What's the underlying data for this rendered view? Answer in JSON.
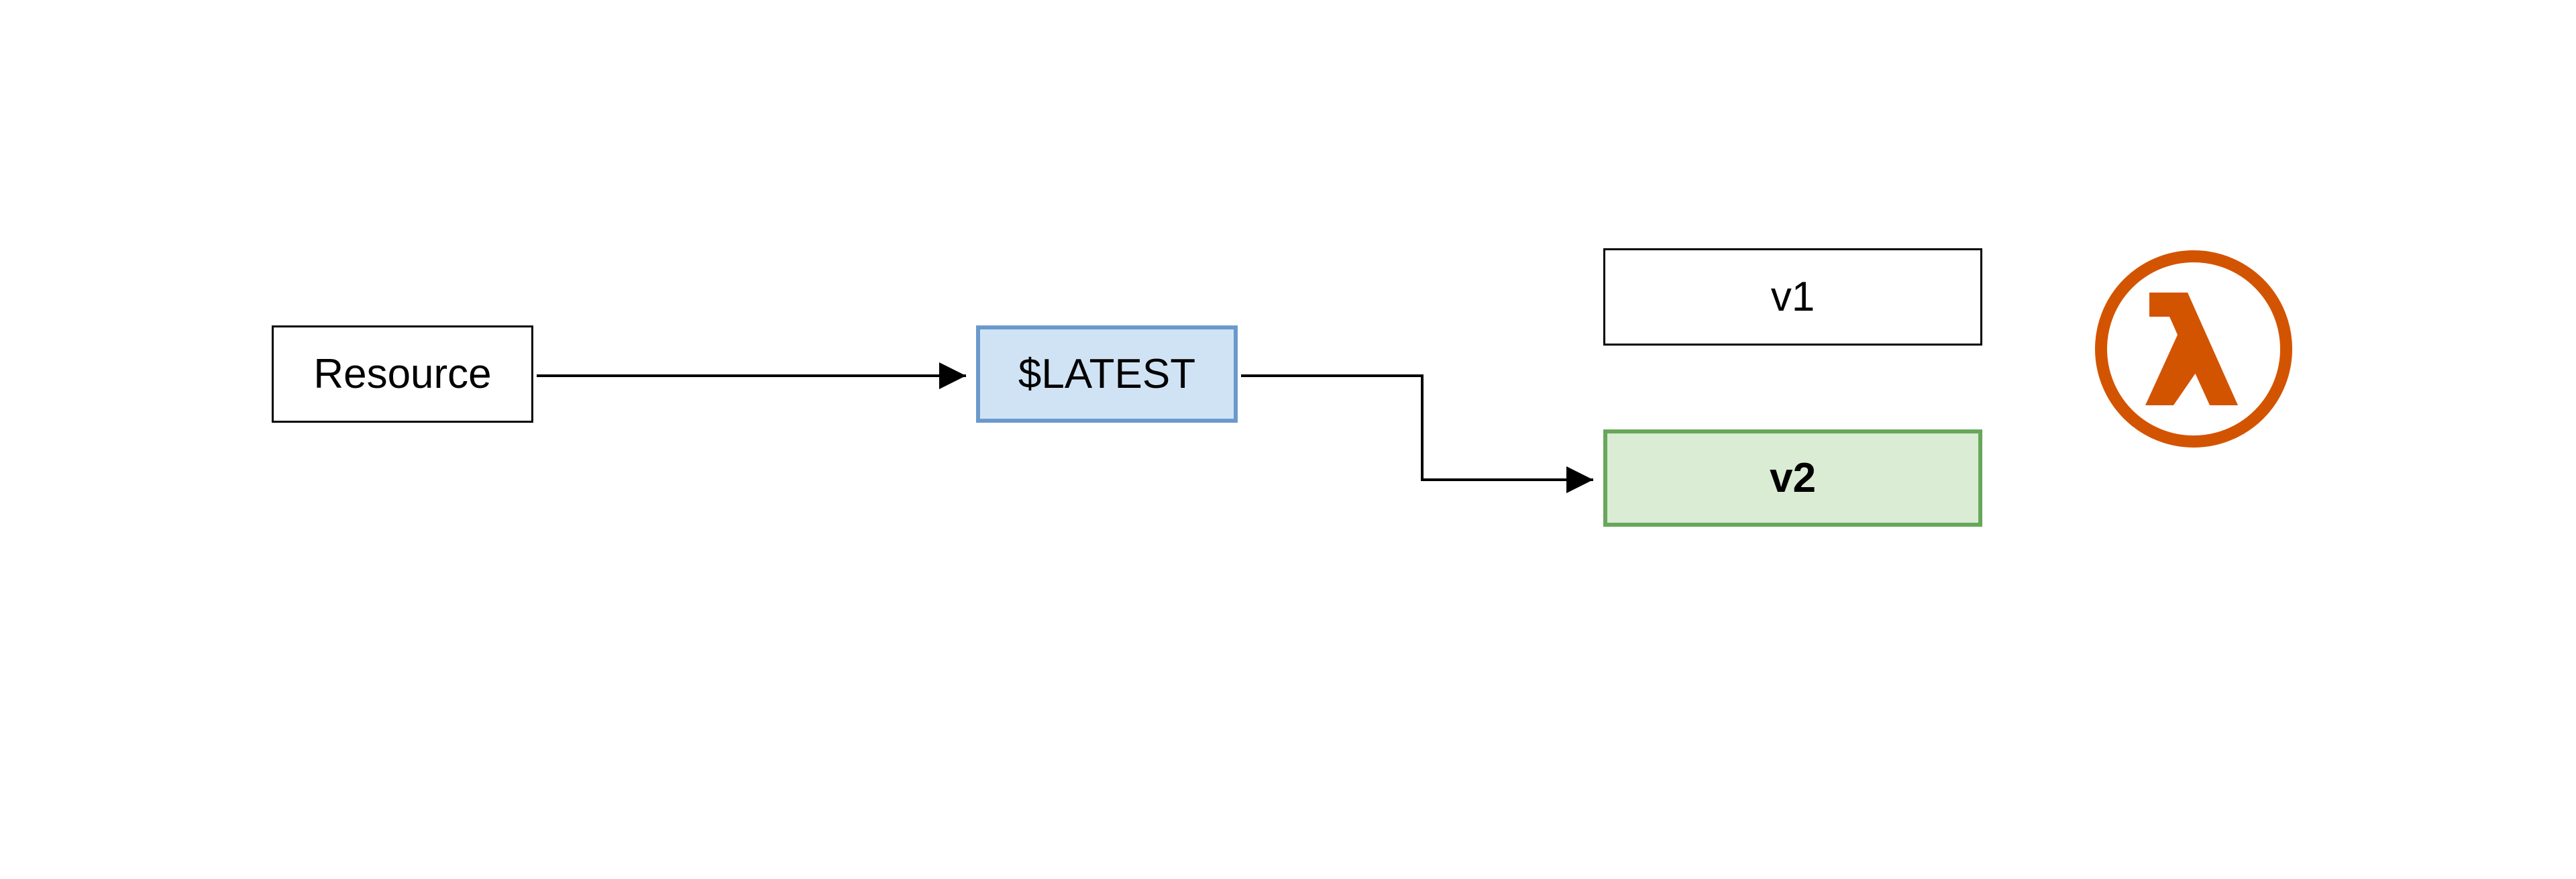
{
  "nodes": {
    "resource": {
      "label": "Resource"
    },
    "latest": {
      "label": "$LATEST"
    },
    "v1": {
      "label": "v1"
    },
    "v2": {
      "label": "v2"
    }
  },
  "icon": {
    "name": "aws-lambda",
    "color": "#d35400"
  },
  "edges": [
    {
      "from": "resource",
      "to": "latest"
    },
    {
      "from": "latest",
      "to": "v2"
    }
  ],
  "colors": {
    "latest_bg": "#d0e3f5",
    "latest_border": "#6a9acb",
    "v2_bg": "#daecd3",
    "v2_border": "#68a75b",
    "lambda": "#d35400"
  }
}
